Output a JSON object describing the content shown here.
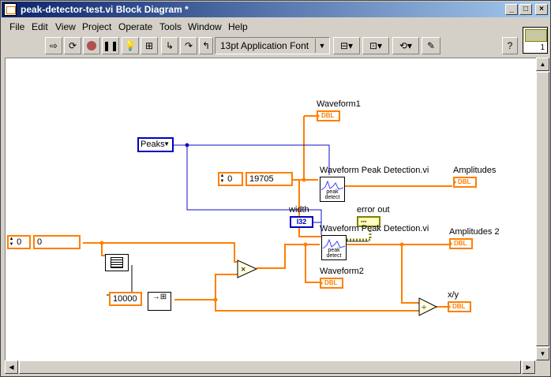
{
  "window": {
    "title": "peak-detector-test.vi Block Diagram *"
  },
  "menu": [
    "File",
    "Edit",
    "View",
    "Project",
    "Operate",
    "Tools",
    "Window",
    "Help"
  ],
  "toolbar": {
    "font_select": "13pt Application Font",
    "help": "?",
    "vi_icon_num": "1"
  },
  "diagram": {
    "peaks_ring": "Peaks",
    "const_19705": "19705",
    "const_a": "0",
    "ctl0_left": "0",
    "ctl0_value": "0",
    "const_10000": "10000",
    "width_label": "width",
    "width_const": "I32",
    "error_out_label": "error out",
    "waveform1_label": "Waveform1",
    "waveform2_label": "Waveform2",
    "amplitudes_label": "Amplitudes",
    "amplitudes2_label": "Amplitudes 2",
    "xy_label": "x/y",
    "peak_vi1_label": "Waveform Peak Detection.vi",
    "peak_vi2_label": "Waveform Peak Detection.vi",
    "peak_icon_text": "peak detect",
    "dbl": "DBL",
    "mult": "×",
    "div": "÷"
  }
}
